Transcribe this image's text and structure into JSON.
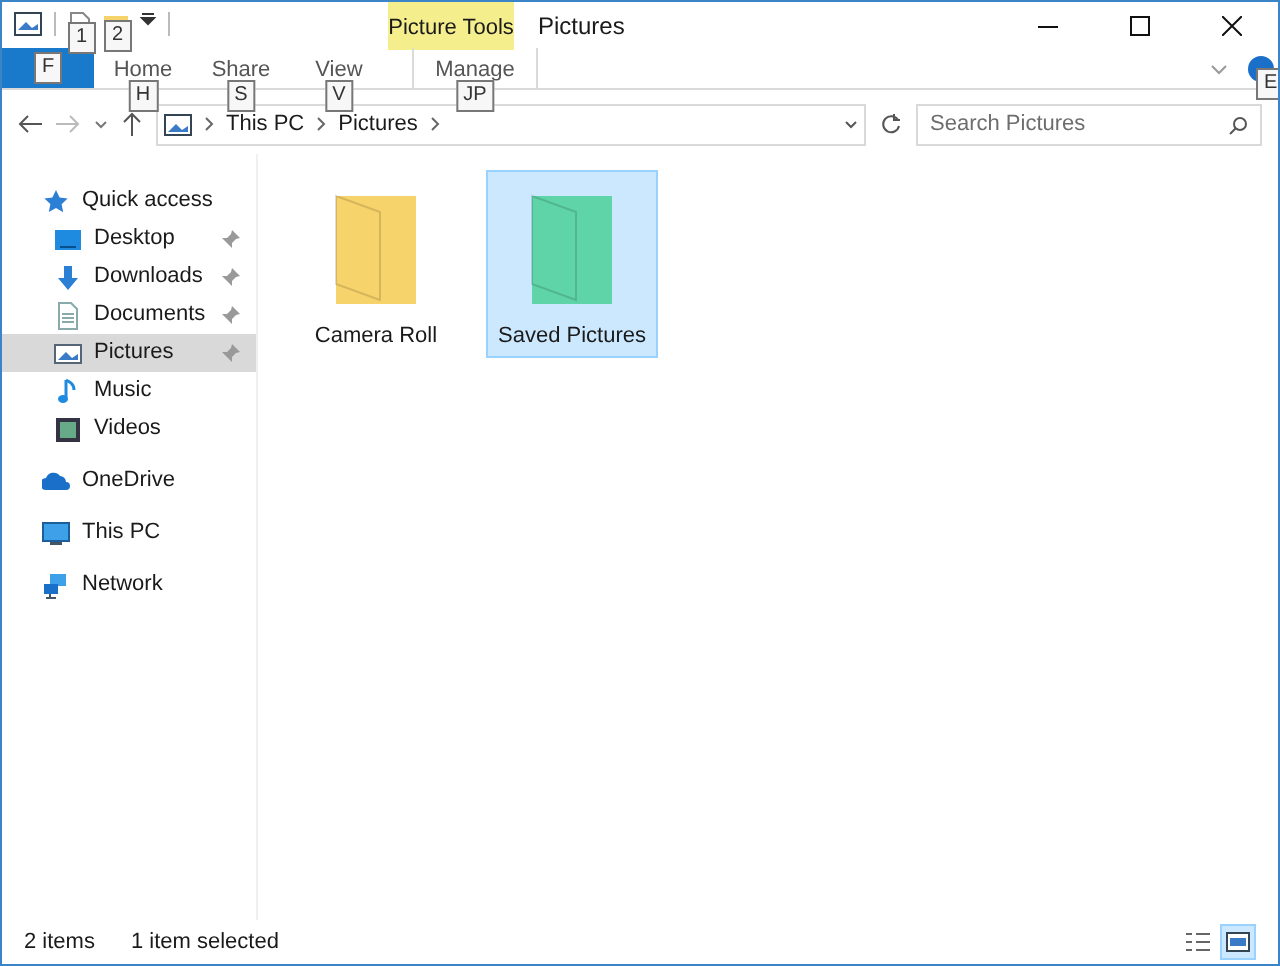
{
  "window": {
    "title": "Pictures",
    "tool_group": "Picture Tools"
  },
  "quick_access_toolbar": [
    {
      "keytip": "1"
    },
    {
      "keytip": "2"
    }
  ],
  "file_tab": {
    "keytip": "F"
  },
  "ribbon_tabs": [
    {
      "label": "Home",
      "keytip": "H",
      "contextual": false
    },
    {
      "label": "Share",
      "keytip": "S",
      "contextual": false
    },
    {
      "label": "View",
      "keytip": "V",
      "contextual": false
    },
    {
      "label": "Manage",
      "keytip": "JP",
      "contextual": true
    }
  ],
  "help": {
    "keytip": "E"
  },
  "address": [
    "This PC",
    "Pictures"
  ],
  "search": {
    "placeholder": "Search Pictures"
  },
  "sidebar": [
    {
      "label": "Quick access",
      "kind": "star",
      "selected": false,
      "children": [
        {
          "label": "Desktop",
          "kind": "desktop",
          "pinned": true,
          "selected": false
        },
        {
          "label": "Downloads",
          "kind": "download",
          "pinned": true,
          "selected": false
        },
        {
          "label": "Documents",
          "kind": "document",
          "pinned": true,
          "selected": false
        },
        {
          "label": "Pictures",
          "kind": "picture",
          "pinned": true,
          "selected": true
        },
        {
          "label": "Music",
          "kind": "music",
          "pinned": false,
          "selected": false
        },
        {
          "label": "Videos",
          "kind": "video",
          "pinned": false,
          "selected": false
        }
      ]
    },
    {
      "label": "OneDrive",
      "kind": "cloud",
      "selected": false
    },
    {
      "label": "This PC",
      "kind": "computer",
      "selected": false
    },
    {
      "label": "Network",
      "kind": "network",
      "selected": false
    }
  ],
  "folders": [
    {
      "name": "Camera Roll",
      "color": "#f6d36b",
      "selected": false
    },
    {
      "name": "Saved Pictures",
      "color": "#5fd4a8",
      "selected": true
    }
  ],
  "status_bar": {
    "count": "2 items",
    "selection": "1 item selected"
  },
  "view_buttons": [
    {
      "kind": "details",
      "selected": false
    },
    {
      "kind": "large",
      "selected": true
    }
  ]
}
